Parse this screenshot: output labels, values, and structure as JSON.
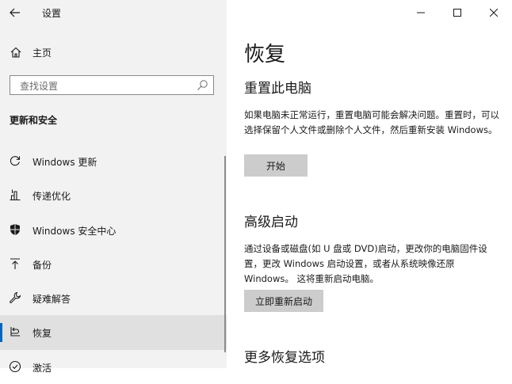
{
  "window": {
    "title": "设置",
    "controls": [
      "minimize-icon",
      "maximize-icon",
      "close-icon"
    ]
  },
  "sidebar": {
    "home_label": "主页",
    "search": {
      "placeholder": "查找设置",
      "value": ""
    },
    "section_heading": "更新和安全",
    "items": [
      {
        "label": "Windows 更新",
        "icon": "refresh-icon"
      },
      {
        "label": "传递优化",
        "icon": "delivery-optimization-icon"
      },
      {
        "label": "Windows 安全中心",
        "icon": "shield-icon"
      },
      {
        "label": "备份",
        "icon": "backup-arrow-icon"
      },
      {
        "label": "疑难解答",
        "icon": "wrench-icon"
      },
      {
        "label": "恢复",
        "icon": "recovery-icon",
        "selected": true
      },
      {
        "label": "激活",
        "icon": "activation-check-icon"
      }
    ]
  },
  "main": {
    "title": "恢复",
    "reset": {
      "heading": "重置此电脑",
      "description": "如果电脑未正常运行，重置电脑可能会解决问题。重置时，可以选择保留个人文件或删除个人文件，然后重新安装 Windows。",
      "button_label": "开始"
    },
    "advanced": {
      "heading": "高级启动",
      "description": "通过设备或磁盘(如 U 盘或 DVD)启动，更改你的电脑固件设置，更改 Windows 启动设置，或者从系统映像还原 Windows。 这将重新启动电脑。",
      "button_label": "立即重新启动"
    },
    "more": {
      "heading": "更多恢复选项"
    }
  },
  "colors": {
    "sidebar_bg": "#f2f2f2",
    "selected_bg": "#e0e0e0",
    "accent": "#0067c0",
    "button_bg": "#cccccc"
  }
}
